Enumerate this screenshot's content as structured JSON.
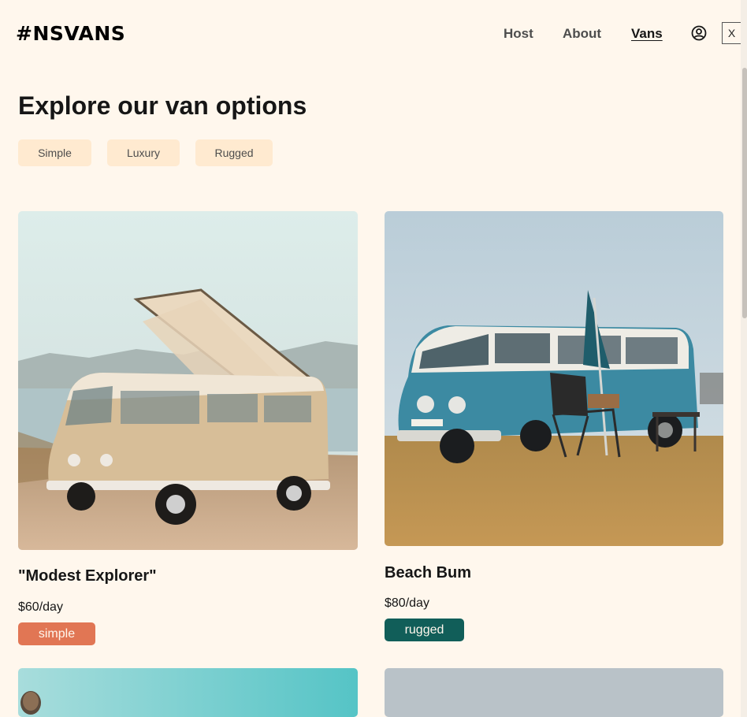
{
  "header": {
    "logo": "#NSVANS",
    "nav": {
      "host": "Host",
      "about": "About",
      "vans": "Vans"
    },
    "close_label": "X"
  },
  "main": {
    "title": "Explore our van options",
    "filters": [
      "Simple",
      "Luxury",
      "Rugged"
    ]
  },
  "vans": [
    {
      "name": "\"Modest Explorer\"",
      "price": "$60/day",
      "type": "simple",
      "type_color": "#E17654"
    },
    {
      "name": "Beach Bum",
      "price": "$80/day",
      "type": "rugged",
      "type_color": "#115E59"
    }
  ],
  "colors": {
    "background": "#FFF7ED",
    "filter_bg": "#FFEAD0",
    "simple": "#E17654",
    "rugged": "#115E59"
  }
}
